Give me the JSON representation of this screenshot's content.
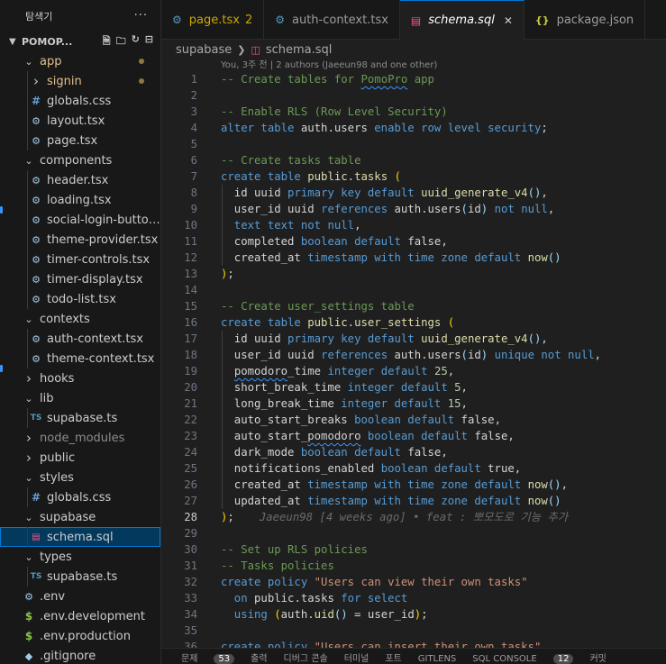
{
  "sidebar": {
    "title": "탐색기",
    "more": "···",
    "project": "POMOP...",
    "tree": [
      {
        "label": "app",
        "type": "folder-open",
        "depth": 1,
        "mod": true
      },
      {
        "label": "signin",
        "type": "folder-closed",
        "depth": 2,
        "mod": true
      },
      {
        "label": "globals.css",
        "type": "css",
        "depth": 2
      },
      {
        "label": "layout.tsx",
        "type": "tsx",
        "depth": 2
      },
      {
        "label": "page.tsx",
        "type": "tsx",
        "depth": 2
      },
      {
        "label": "components",
        "type": "folder-open",
        "depth": 1
      },
      {
        "label": "header.tsx",
        "type": "tsx",
        "depth": 2
      },
      {
        "label": "loading.tsx",
        "type": "tsx",
        "depth": 2
      },
      {
        "label": "social-login-button...",
        "type": "tsx",
        "depth": 2
      },
      {
        "label": "theme-provider.tsx",
        "type": "tsx",
        "depth": 2
      },
      {
        "label": "timer-controls.tsx",
        "type": "tsx",
        "depth": 2
      },
      {
        "label": "timer-display.tsx",
        "type": "tsx",
        "depth": 2
      },
      {
        "label": "todo-list.tsx",
        "type": "tsx",
        "depth": 2
      },
      {
        "label": "contexts",
        "type": "folder-open",
        "depth": 1
      },
      {
        "label": "auth-context.tsx",
        "type": "tsx",
        "depth": 2
      },
      {
        "label": "theme-context.tsx",
        "type": "tsx",
        "depth": 2
      },
      {
        "label": "hooks",
        "type": "folder-closed",
        "depth": 1
      },
      {
        "label": "lib",
        "type": "folder-open",
        "depth": 1
      },
      {
        "label": "supabase.ts",
        "type": "ts",
        "depth": 2
      },
      {
        "label": "node_modules",
        "type": "folder-closed",
        "depth": 1,
        "dim": true
      },
      {
        "label": "public",
        "type": "folder-closed",
        "depth": 1
      },
      {
        "label": "styles",
        "type": "folder-open",
        "depth": 1
      },
      {
        "label": "globals.css",
        "type": "css",
        "depth": 2
      },
      {
        "label": "supabase",
        "type": "folder-open",
        "depth": 1
      },
      {
        "label": "schema.sql",
        "type": "sql",
        "depth": 2,
        "selected": true
      },
      {
        "label": "types",
        "type": "folder-open",
        "depth": 1
      },
      {
        "label": "supabase.ts",
        "type": "ts",
        "depth": 2
      },
      {
        "label": ".env",
        "type": "env",
        "depth": 1
      },
      {
        "label": ".env.development",
        "type": "dollar",
        "depth": 1
      },
      {
        "label": ".env.production",
        "type": "dollar",
        "depth": 1
      },
      {
        "label": ".gitignore",
        "type": "git",
        "depth": 1
      }
    ]
  },
  "tabs": [
    {
      "label": "page.tsx",
      "icon": "gear-icon",
      "badge": "2",
      "warn": true
    },
    {
      "label": "auth-context.tsx",
      "icon": "gear-icon"
    },
    {
      "label": "schema.sql",
      "icon": "database-icon",
      "active": true,
      "close": "✕"
    },
    {
      "label": "package.json",
      "icon": "json-icon"
    }
  ],
  "breadcrumb": {
    "folder": "supabase",
    "file": "schema.sql"
  },
  "editor": {
    "blame_header": "You, 3주 전 | 2 authors (Jaeeun98 and one other)",
    "current_line": 28,
    "inline_blame": "Jaeeun98 [4 weeks ago] • feat : 뽀모도로 기능 추가",
    "lines": [
      {
        "n": 1,
        "tokens": [
          [
            "cm",
            "-- Create tables for "
          ],
          [
            "cm sq",
            "PomoPro"
          ],
          [
            "cm",
            " app"
          ]
        ]
      },
      {
        "n": 2,
        "tokens": []
      },
      {
        "n": 3,
        "tokens": [
          [
            "cm",
            "-- Enable RLS (Row Level Security)"
          ]
        ]
      },
      {
        "n": 4,
        "tokens": [
          [
            "kw",
            "alter table "
          ],
          [
            "id",
            "auth.users "
          ],
          [
            "kw",
            "enable row level security"
          ],
          [
            "id",
            ";"
          ]
        ]
      },
      {
        "n": 5,
        "tokens": []
      },
      {
        "n": 6,
        "tokens": [
          [
            "cm",
            "-- Create tasks table"
          ]
        ]
      },
      {
        "n": 7,
        "tokens": [
          [
            "kw",
            "create table "
          ],
          [
            "fn",
            "public"
          ],
          [
            "id",
            "."
          ],
          [
            "fn",
            "tasks"
          ],
          [
            "id",
            " "
          ],
          [
            "pa",
            "("
          ]
        ]
      },
      {
        "n": 8,
        "g": true,
        "tokens": [
          [
            "id",
            "  id uuid "
          ],
          [
            "kw",
            "primary key default "
          ],
          [
            "fn",
            "uuid_generate_v4"
          ],
          [
            "bl",
            "()"
          ],
          [
            "id",
            ","
          ]
        ]
      },
      {
        "n": 9,
        "g": true,
        "tokens": [
          [
            "id",
            "  user_id uuid "
          ],
          [
            "kw",
            "references "
          ],
          [
            "id",
            "auth.users"
          ],
          [
            "bl",
            "("
          ],
          [
            "id",
            "id"
          ],
          [
            "bl",
            ")"
          ],
          [
            "kw",
            " not null"
          ],
          [
            "id",
            ","
          ]
        ]
      },
      {
        "n": 10,
        "g": true,
        "tokens": [
          [
            "kw",
            "  text text not null"
          ],
          [
            "id",
            ","
          ]
        ]
      },
      {
        "n": 11,
        "g": true,
        "tokens": [
          [
            "id",
            "  completed "
          ],
          [
            "kw",
            "boolean default "
          ],
          [
            "id",
            "false,"
          ]
        ]
      },
      {
        "n": 12,
        "g": true,
        "tokens": [
          [
            "id",
            "  created_at "
          ],
          [
            "kw",
            "timestamp with time zone default "
          ],
          [
            "fn",
            "now"
          ],
          [
            "bl",
            "()"
          ]
        ]
      },
      {
        "n": 13,
        "tokens": [
          [
            "pa",
            ")"
          ],
          [
            "id",
            ";"
          ]
        ]
      },
      {
        "n": 14,
        "tokens": []
      },
      {
        "n": 15,
        "tokens": [
          [
            "cm",
            "-- Create user_settings table"
          ]
        ]
      },
      {
        "n": 16,
        "tokens": [
          [
            "kw",
            "create table "
          ],
          [
            "fn",
            "public"
          ],
          [
            "id",
            "."
          ],
          [
            "fn",
            "user_settings"
          ],
          [
            "id",
            " "
          ],
          [
            "pa",
            "("
          ]
        ]
      },
      {
        "n": 17,
        "g": true,
        "tokens": [
          [
            "id",
            "  id uuid "
          ],
          [
            "kw",
            "primary key default "
          ],
          [
            "fn",
            "uuid_generate_v4"
          ],
          [
            "bl",
            "()"
          ],
          [
            "id",
            ","
          ]
        ]
      },
      {
        "n": 18,
        "g": true,
        "tokens": [
          [
            "id",
            "  user_id uuid "
          ],
          [
            "kw",
            "references "
          ],
          [
            "id",
            "auth.users"
          ],
          [
            "bl",
            "("
          ],
          [
            "id",
            "id"
          ],
          [
            "bl",
            ")"
          ],
          [
            "kw",
            " unique not null"
          ],
          [
            "id",
            ","
          ]
        ]
      },
      {
        "n": 19,
        "g": true,
        "tokens": [
          [
            "id",
            "  "
          ],
          [
            "id sq",
            "pomodoro"
          ],
          [
            "id",
            "_time "
          ],
          [
            "kw",
            "integer default "
          ],
          [
            "nm",
            "25"
          ],
          [
            "id",
            ","
          ]
        ]
      },
      {
        "n": 20,
        "g": true,
        "tokens": [
          [
            "id",
            "  short_break_time "
          ],
          [
            "kw",
            "integer default "
          ],
          [
            "nm",
            "5"
          ],
          [
            "id",
            ","
          ]
        ]
      },
      {
        "n": 21,
        "g": true,
        "tokens": [
          [
            "id",
            "  long_break_time "
          ],
          [
            "kw",
            "integer default "
          ],
          [
            "nm",
            "15"
          ],
          [
            "id",
            ","
          ]
        ]
      },
      {
        "n": 22,
        "g": true,
        "tokens": [
          [
            "id",
            "  auto_start_breaks "
          ],
          [
            "kw",
            "boolean default "
          ],
          [
            "id",
            "false,"
          ]
        ]
      },
      {
        "n": 23,
        "g": true,
        "tokens": [
          [
            "id",
            "  auto_start_"
          ],
          [
            "id sq",
            "pomodoro"
          ],
          [
            "id",
            " "
          ],
          [
            "kw",
            "boolean default "
          ],
          [
            "id",
            "false,"
          ]
        ]
      },
      {
        "n": 24,
        "g": true,
        "tokens": [
          [
            "id",
            "  dark_mode "
          ],
          [
            "kw",
            "boolean default "
          ],
          [
            "id",
            "false,"
          ]
        ]
      },
      {
        "n": 25,
        "g": true,
        "tokens": [
          [
            "id",
            "  notifications_enabled "
          ],
          [
            "kw",
            "boolean default "
          ],
          [
            "id",
            "true,"
          ]
        ]
      },
      {
        "n": 26,
        "g": true,
        "tokens": [
          [
            "id",
            "  created_at "
          ],
          [
            "kw",
            "timestamp with time zone default "
          ],
          [
            "fn",
            "now"
          ],
          [
            "bl",
            "()"
          ],
          [
            "id",
            ","
          ]
        ]
      },
      {
        "n": 27,
        "g": true,
        "tokens": [
          [
            "id",
            "  updated_at "
          ],
          [
            "kw",
            "timestamp with time zone default "
          ],
          [
            "fn",
            "now"
          ],
          [
            "bl",
            "()"
          ]
        ]
      },
      {
        "n": 28,
        "tokens": [
          [
            "pa",
            ")"
          ],
          [
            "id",
            ";"
          ]
        ],
        "blame": true
      },
      {
        "n": 29,
        "tokens": []
      },
      {
        "n": 30,
        "tokens": [
          [
            "cm",
            "-- Set up RLS policies"
          ]
        ]
      },
      {
        "n": 31,
        "tokens": [
          [
            "cm",
            "-- Tasks policies"
          ]
        ]
      },
      {
        "n": 32,
        "tokens": [
          [
            "kw",
            "create policy "
          ],
          [
            "st",
            "\"Users can view their own tasks\""
          ]
        ]
      },
      {
        "n": 33,
        "tokens": [
          [
            "kw",
            "  on "
          ],
          [
            "id",
            "public.tasks "
          ],
          [
            "kw",
            "for select"
          ]
        ]
      },
      {
        "n": 34,
        "tokens": [
          [
            "kw",
            "  using "
          ],
          [
            "pa",
            "("
          ],
          [
            "id",
            "auth."
          ],
          [
            "fn",
            "uid"
          ],
          [
            "bl",
            "()"
          ],
          [
            "id",
            " = user_id"
          ],
          [
            "pa",
            ")"
          ],
          [
            "id",
            ";"
          ]
        ]
      },
      {
        "n": 35,
        "tokens": []
      },
      {
        "n": 36,
        "tokens": [
          [
            "kw",
            "create policy "
          ],
          [
            "st",
            "\"Users can insert their own tasks\""
          ]
        ]
      }
    ]
  },
  "panel": {
    "items": [
      "문제",
      "53",
      "출력",
      "디버그 콘솔",
      "터미널",
      "포트",
      "GITLENS",
      "SQL CONSOLE",
      "12",
      "커밋"
    ]
  },
  "colors": {
    "accent": "#0078d4",
    "modified": "#e2c08d",
    "sql_icon": "#f55385"
  }
}
